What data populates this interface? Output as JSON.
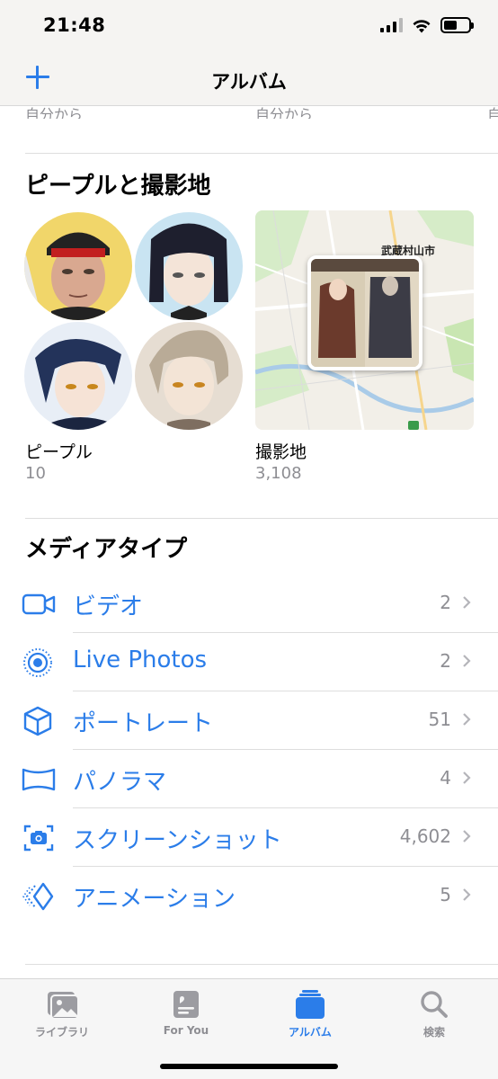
{
  "status_bar": {
    "time": "21:48"
  },
  "nav": {
    "title": "アルバム",
    "add_icon": "plus-icon"
  },
  "cut_row": {
    "labels": [
      "自分から",
      "自分から",
      "自"
    ]
  },
  "people_places": {
    "title": "ピープルと撮影地",
    "people": {
      "label": "ピープル",
      "count": "10"
    },
    "places": {
      "label": "撮影地",
      "count": "3,108",
      "map_label": "武蔵村山市"
    }
  },
  "media_types": {
    "title": "メディアタイプ",
    "items": [
      {
        "icon": "video-icon",
        "label": "ビデオ",
        "count": "2"
      },
      {
        "icon": "live-photos-icon",
        "label": "Live Photos",
        "count": "2"
      },
      {
        "icon": "portrait-cube-icon",
        "label": "ポートレート",
        "count": "51"
      },
      {
        "icon": "panorama-icon",
        "label": "パノラマ",
        "count": "4"
      },
      {
        "icon": "screenshot-icon",
        "label": "スクリーンショット",
        "count": "4,602"
      },
      {
        "icon": "animation-icon",
        "label": "アニメーション",
        "count": "5"
      }
    ]
  },
  "tab_bar": {
    "tabs": [
      {
        "label": "ライブラリ",
        "icon": "photo-library-icon",
        "active": false
      },
      {
        "label": "For You",
        "icon": "for-you-icon",
        "active": false
      },
      {
        "label": "アルバム",
        "icon": "albums-icon",
        "active": true
      },
      {
        "label": "検索",
        "icon": "search-icon",
        "active": false
      }
    ]
  },
  "colors": {
    "accent": "#2b7de9",
    "secondary_text": "#8e8e93"
  }
}
